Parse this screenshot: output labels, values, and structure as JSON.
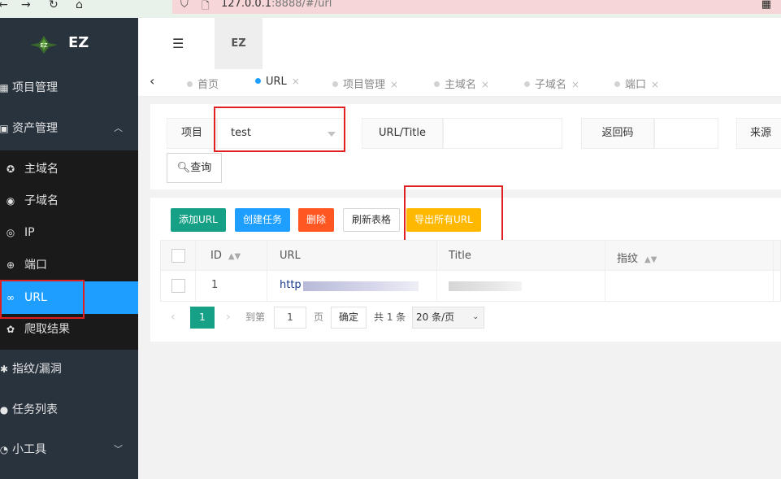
{
  "browser": {
    "back_icon": "←",
    "forward_icon": "→",
    "reload_icon": "↻",
    "home_icon": "⌂",
    "url_host": "127.0.0.1",
    "url_rest": ":8888/#/url"
  },
  "sidebar": {
    "logo_text": "EZ",
    "items": [
      {
        "label": "项目管理",
        "icon": "grid-icon"
      },
      {
        "label": "资产管理",
        "icon": "box-icon",
        "arrow": "︿"
      },
      {
        "label": "指纹/漏洞",
        "icon": "bug-icon"
      },
      {
        "label": "任务列表",
        "icon": "list-icon"
      },
      {
        "label": "小工具",
        "icon": "tool-icon",
        "arrow": "﹀"
      }
    ],
    "sub_items": [
      {
        "label": "主域名",
        "icon": "domain-icon"
      },
      {
        "label": "子域名",
        "icon": "globe-icon"
      },
      {
        "label": "IP",
        "icon": "location-icon"
      },
      {
        "label": "端口",
        "icon": "plug-icon"
      },
      {
        "label": "URL",
        "icon": "link-icon"
      },
      {
        "label": "爬取结果",
        "icon": "paw-icon"
      }
    ]
  },
  "header": {
    "tab_label": "EZ"
  },
  "tabs": [
    {
      "label": "首页"
    },
    {
      "label": "URL",
      "close": "×"
    },
    {
      "label": "项目管理",
      "close": "×"
    },
    {
      "label": "主域名",
      "close": "×"
    },
    {
      "label": "子域名",
      "close": "×"
    },
    {
      "label": "端口",
      "close": "×"
    }
  ],
  "filters": {
    "project_label": "项目",
    "project_value": "test",
    "url_title_label": "URL/Title",
    "status_label": "返回码",
    "source_label": "来源",
    "search_button": "查询"
  },
  "toolbar": {
    "add_url": "添加URL",
    "create_task": "创建任务",
    "delete": "删除",
    "refresh_table": "刷新表格",
    "export_all_url": "导出所有URL"
  },
  "table": {
    "headers": [
      "ID",
      "URL",
      "Title",
      "指纹"
    ],
    "rows": [
      {
        "id": "1",
        "url": "http"
      }
    ]
  },
  "pager": {
    "current": "1",
    "goto_label": "到第",
    "page_input": "1",
    "page_unit": "页",
    "confirm": "确定",
    "total": "共 1 条",
    "page_size": "20 条/页"
  },
  "colors": {
    "sidebar_bg": "#28333e",
    "active_blue": "#1e9fff",
    "teal": "#16a085",
    "orange_red": "#ff5722",
    "yellow": "#ffb800",
    "highlight_red": "#e02020"
  }
}
